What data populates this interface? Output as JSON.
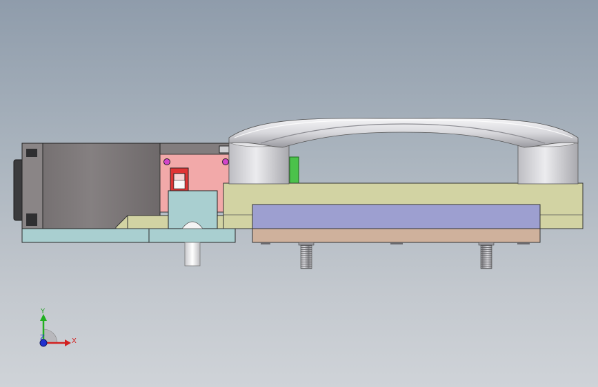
{
  "triad": {
    "x_label": "X",
    "y_label": "Y",
    "z_label": "Z"
  },
  "colors": {
    "background_top": "#8f9cab",
    "background_bottom": "#cfd3d8",
    "motor_body": "#7c7677",
    "bracket_pink": "#f2a9a9",
    "block_cyan": "#a9cfd0",
    "plate_olive": "#d2d3a3",
    "plate_purple": "#9d9fd0",
    "plate_tan": "#cfb19c",
    "handle_grey": "#d6d6da",
    "tab_green": "#4bc24b",
    "screw_magenta": "#d244c9",
    "axis_x": "#d22020",
    "axis_y": "#20b020",
    "axis_z": "#2030d0"
  }
}
